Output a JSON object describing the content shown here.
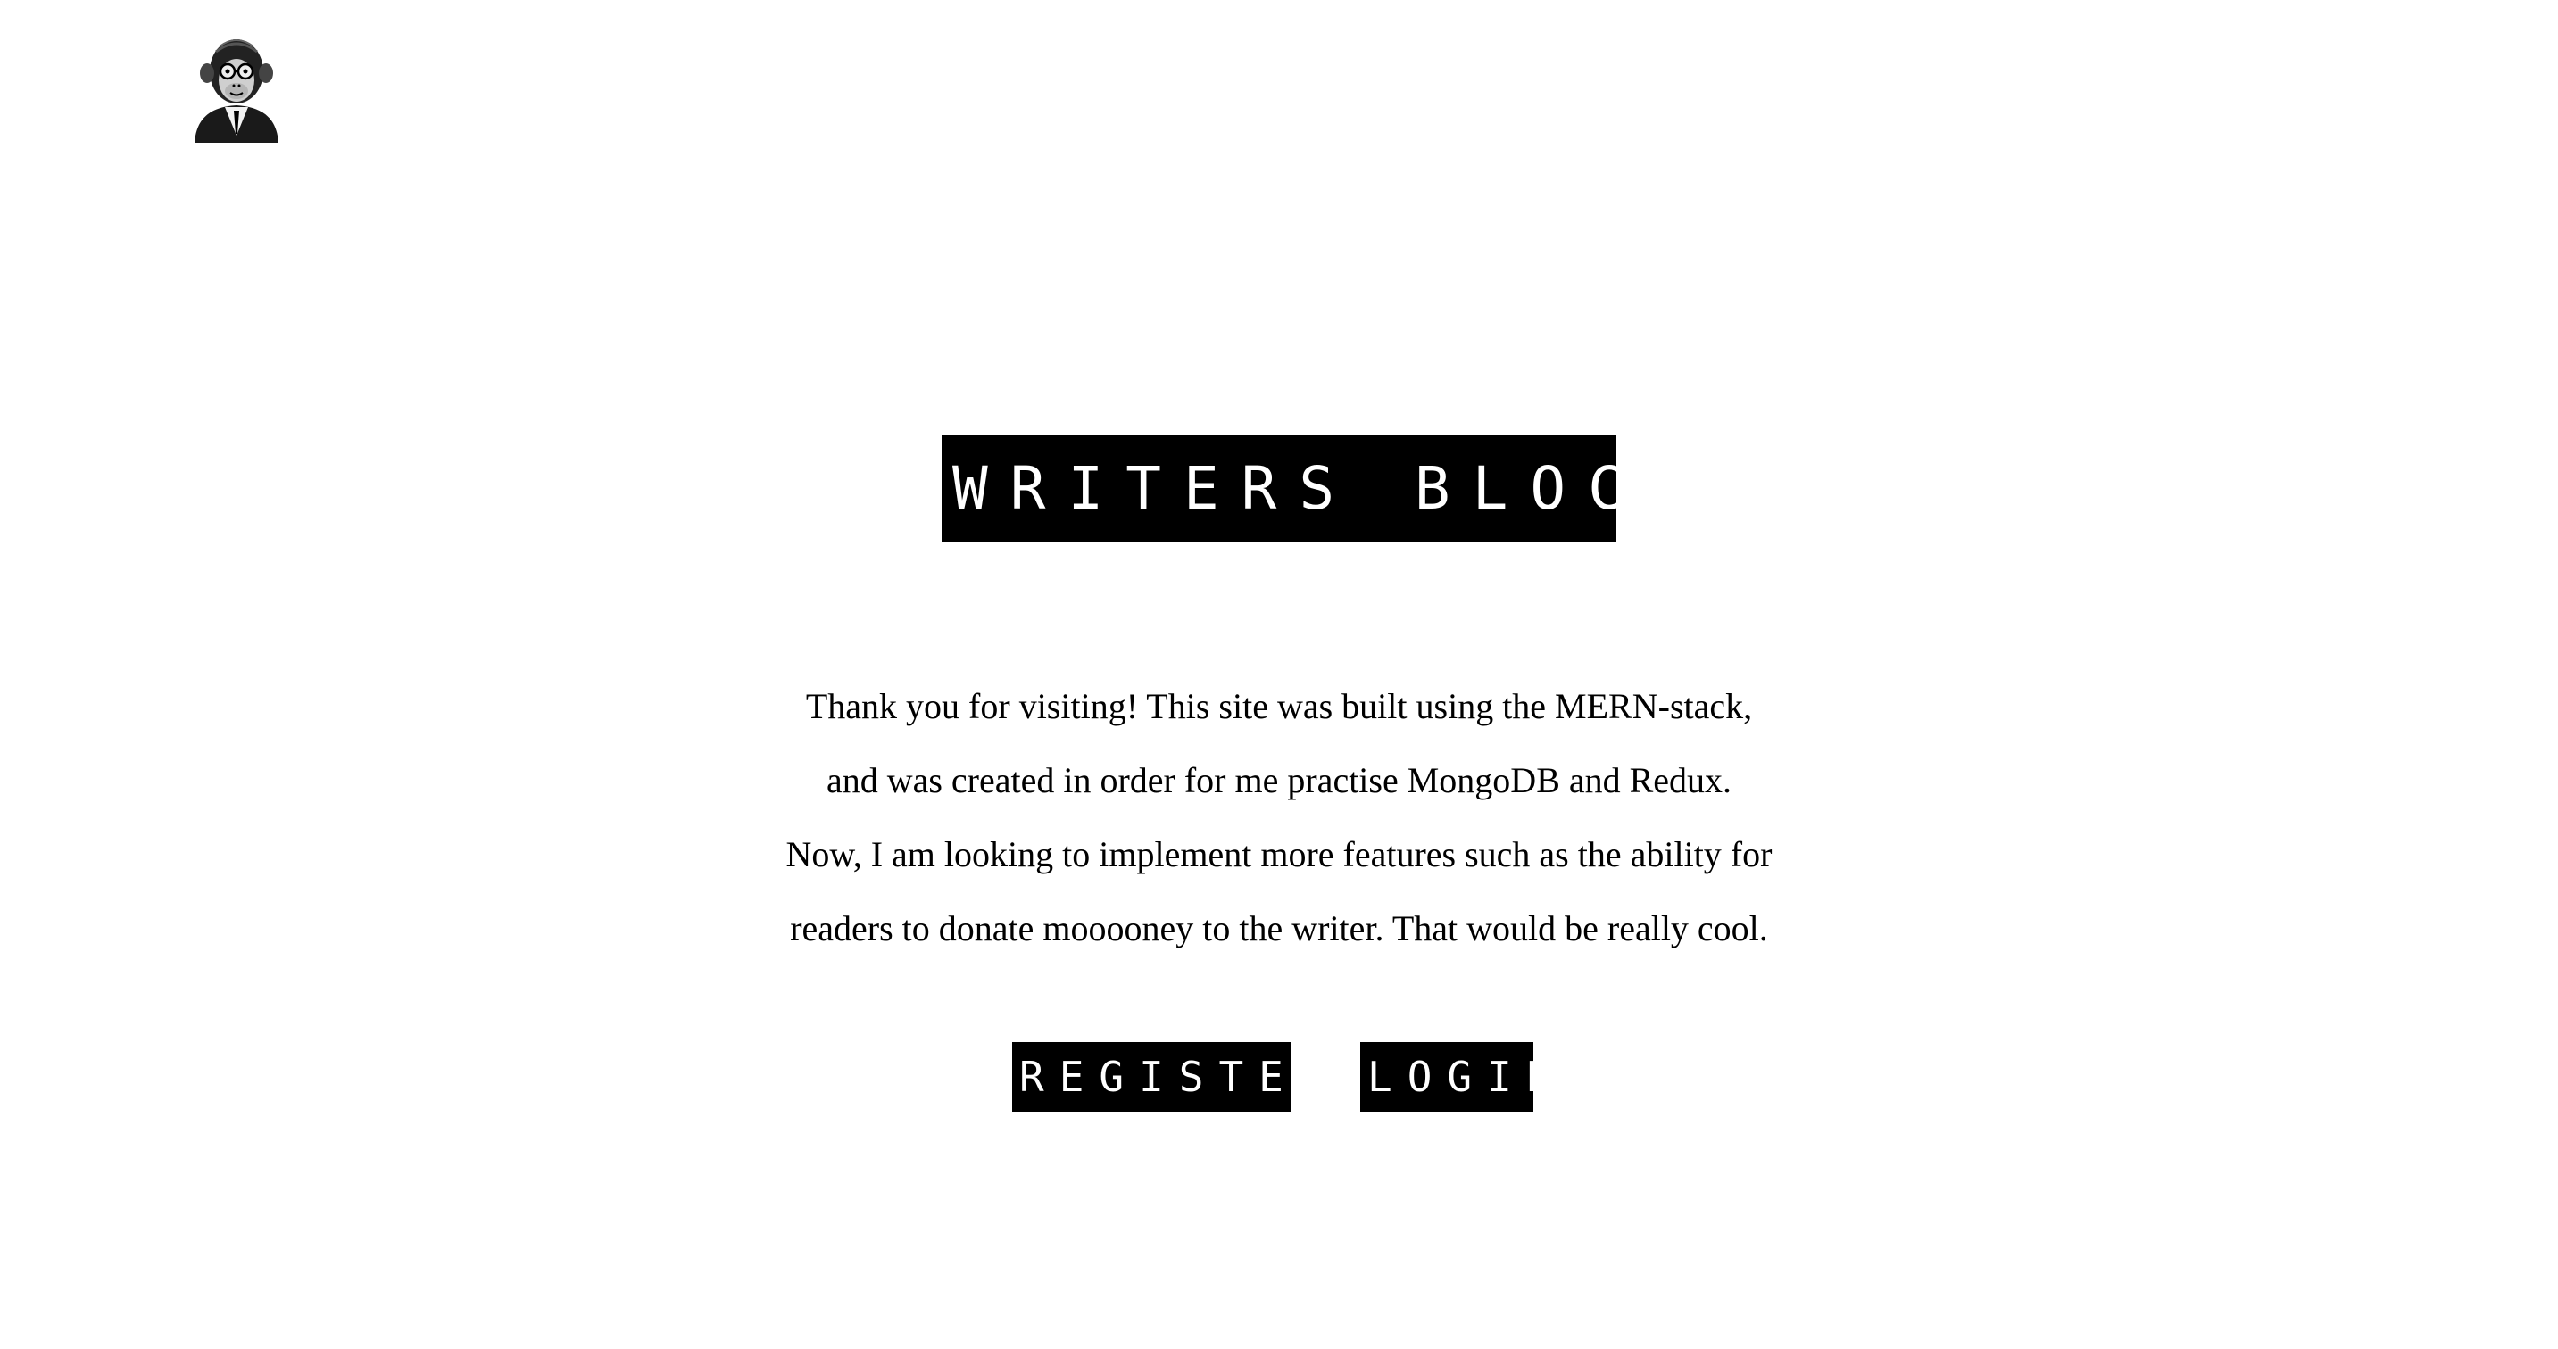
{
  "header": {
    "logo_icon": "monkey-in-suit-logo"
  },
  "hero": {
    "title": "WRITERS BLOCK"
  },
  "intro": {
    "lines": [
      "Thank you for visiting! This site was built using the MERN-stack,",
      "and was created in order for me practise MongoDB and Redux.",
      "Now, I am looking to implement more features such as the ability for",
      "readers to donate mooooney to the writer. That would be really cool."
    ]
  },
  "actions": {
    "register_label": "REGISTER",
    "login_label": "LOGIN"
  },
  "colors": {
    "background": "#ffffff",
    "text": "#000000",
    "button_bg": "#000000",
    "button_text": "#ffffff"
  }
}
